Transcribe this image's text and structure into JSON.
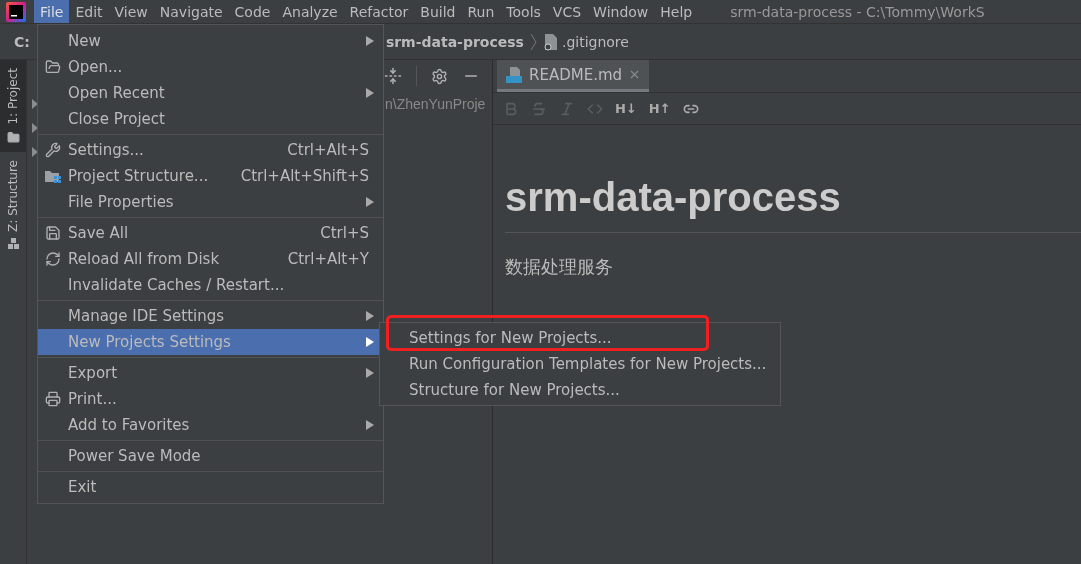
{
  "menu_bar": {
    "items": [
      {
        "label": "File",
        "selected": true
      },
      {
        "label": "Edit",
        "selected": false
      },
      {
        "label": "View",
        "selected": false
      },
      {
        "label": "Navigate",
        "selected": false
      },
      {
        "label": "Code",
        "selected": false
      },
      {
        "label": "Analyze",
        "selected": false
      },
      {
        "label": "Refactor",
        "selected": false
      },
      {
        "label": "Build",
        "selected": false
      },
      {
        "label": "Run",
        "selected": false
      },
      {
        "label": "Tools",
        "selected": false
      },
      {
        "label": "VCS",
        "selected": false
      },
      {
        "label": "Window",
        "selected": false
      },
      {
        "label": "Help",
        "selected": false
      }
    ],
    "window_title": "srm-data-process - C:\\Tommy\\WorkS"
  },
  "navigation_bar": {
    "drive": "C:",
    "breadcrumbs": [
      "srm-data-process",
      ".gitignore"
    ]
  },
  "tool_window_tabs": [
    {
      "label": "1: Project",
      "selected": true
    },
    {
      "label": "Z: Structure",
      "selected": false
    }
  ],
  "project_panel": {
    "tree_rows": [
      {
        "label": "n\\ZhenYunProje",
        "expanded": false
      },
      {
        "expanded": false
      },
      {
        "expanded": false
      }
    ]
  },
  "editor": {
    "tabs": [
      {
        "label": "README.md",
        "selected": true
      }
    ],
    "markdown_toolbar": [
      {
        "kind": "bold",
        "disabled": true
      },
      {
        "kind": "strikethrough",
        "disabled": true
      },
      {
        "kind": "italic",
        "disabled": true
      },
      {
        "kind": "code",
        "disabled": true
      },
      {
        "kind": "text",
        "label": "H↓",
        "disabled": false
      },
      {
        "kind": "text",
        "label": "H↑",
        "disabled": false
      },
      {
        "kind": "link",
        "disabled": false
      }
    ],
    "document": {
      "heading": "srm-data-process",
      "paragraph": "数据处理服务"
    }
  },
  "file_menu": {
    "groups": [
      [
        {
          "label": "New",
          "submenu": true,
          "selected": false
        },
        {
          "label": "Open...",
          "submenu": false,
          "selected": false
        },
        {
          "label": "Open Recent",
          "submenu": true,
          "selected": false
        },
        {
          "label": "Close Project",
          "submenu": false,
          "selected": false
        }
      ],
      [
        {
          "label": "Settings...",
          "shortcut": "Ctrl+Alt+S",
          "submenu": false,
          "selected": false
        },
        {
          "label": "Project Structure...",
          "shortcut": "Ctrl+Alt+Shift+S",
          "submenu": false,
          "selected": false
        },
        {
          "label": "File Properties",
          "submenu": true,
          "selected": false
        }
      ],
      [
        {
          "label": "Save All",
          "shortcut": "Ctrl+S",
          "submenu": false,
          "selected": false
        },
        {
          "label": "Reload All from Disk",
          "shortcut": "Ctrl+Alt+Y",
          "submenu": false,
          "selected": false
        },
        {
          "label": "Invalidate Caches / Restart...",
          "submenu": false,
          "selected": false
        }
      ],
      [
        {
          "label": "Manage IDE Settings",
          "submenu": true,
          "selected": false
        },
        {
          "label": "New Projects Settings",
          "submenu": true,
          "selected": true
        }
      ],
      [
        {
          "label": "Export",
          "submenu": true,
          "selected": false
        },
        {
          "label": "Print...",
          "submenu": false,
          "selected": false
        },
        {
          "label": "Add to Favorites",
          "submenu": true,
          "selected": false
        }
      ],
      [
        {
          "label": "Power Save Mode",
          "submenu": false,
          "selected": false
        }
      ],
      [
        {
          "label": "Exit",
          "submenu": false,
          "selected": false
        }
      ]
    ]
  },
  "submenu": {
    "items": [
      {
        "label": "Settings for New Projects..."
      },
      {
        "label": "Run Configuration Templates for New Projects..."
      },
      {
        "label": "Structure for New Projects..."
      }
    ]
  }
}
